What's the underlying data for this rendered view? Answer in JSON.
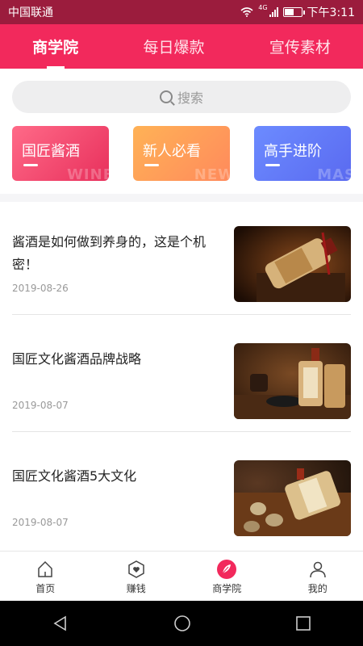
{
  "status": {
    "carrier": "中国联通",
    "network": "4G",
    "time": "下午3:11",
    "battery_level": 0.6
  },
  "top_tabs": [
    {
      "label": "商学院",
      "active": true
    },
    {
      "label": "每日爆款",
      "active": false
    },
    {
      "label": "宣传素材",
      "active": false
    }
  ],
  "search": {
    "placeholder": "搜索"
  },
  "categories": [
    {
      "label": "国匠酱酒",
      "watermark": "WINE"
    },
    {
      "label": "新人必看",
      "watermark": "NEW"
    },
    {
      "label": "高手进阶",
      "watermark": "MAS"
    }
  ],
  "articles": [
    {
      "title": "酱酒是如何做到养身的，这是个机密！",
      "date": "2019-08-26"
    },
    {
      "title": "国匠文化酱酒品牌战略",
      "date": "2019-08-07"
    },
    {
      "title": "国匠文化酱酒5大文化",
      "date": "2019-08-07"
    }
  ],
  "tabbar": [
    {
      "label": "首页",
      "icon": "home-icon",
      "active": false
    },
    {
      "label": "赚钱",
      "icon": "heart-hex-icon",
      "active": false
    },
    {
      "label": "商学院",
      "icon": "leaf-icon",
      "active": true
    },
    {
      "label": "我的",
      "icon": "user-icon",
      "active": false
    }
  ],
  "colors": {
    "brand": "#f2295c",
    "status_bar": "#9b1c3d"
  }
}
